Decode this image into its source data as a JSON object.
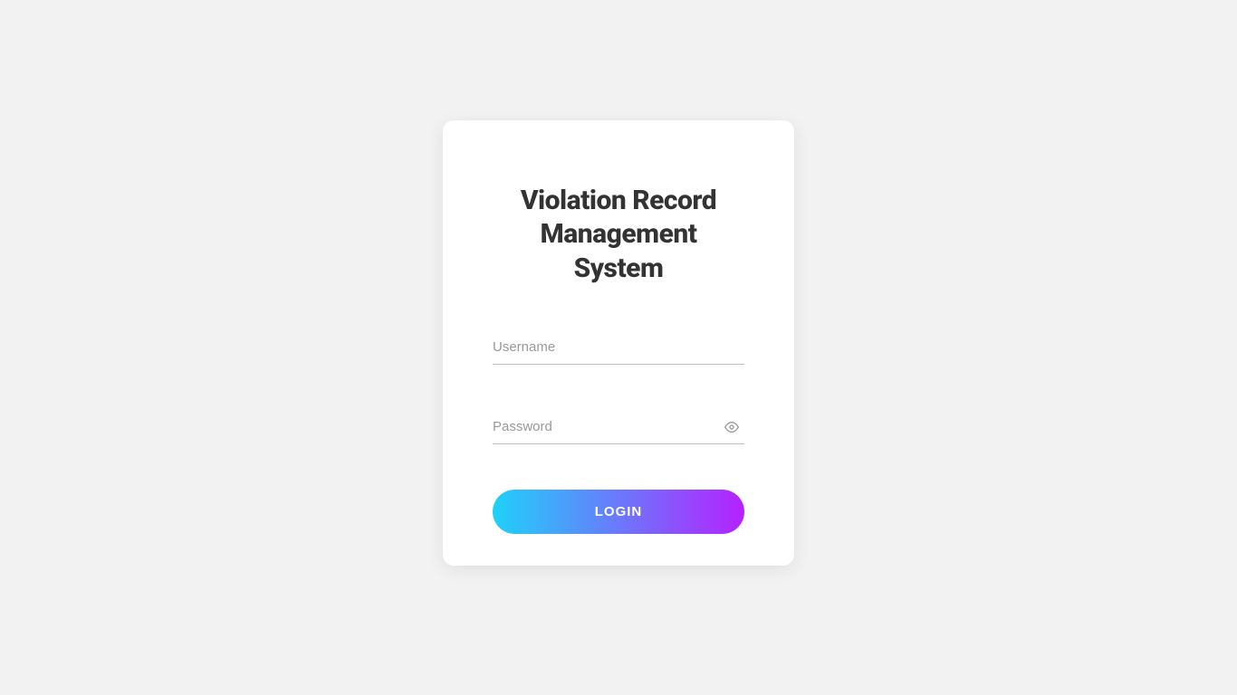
{
  "login": {
    "title": "Violation Record Management System",
    "username_placeholder": "Username",
    "username_value": "",
    "password_placeholder": "Password",
    "password_value": "",
    "login_button_label": "LOGIN"
  }
}
